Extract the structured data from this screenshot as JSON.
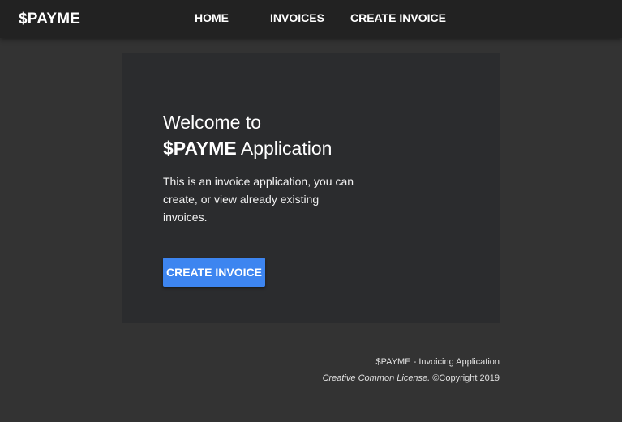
{
  "navbar": {
    "brand": "$PAYME",
    "links": [
      {
        "label": "HOME"
      },
      {
        "label": "INVOICES"
      },
      {
        "label": "CREATE INVOICE"
      }
    ]
  },
  "main": {
    "welcome_line1": "Welcome to",
    "welcome_brand": "$PAYME",
    "welcome_suffix": " Application",
    "description": "This is an invoice application, you can create, or view already existing invoices.",
    "cta_label": "CREATE INVOICE"
  },
  "footer": {
    "line1": "$PAYME - Invoicing Application",
    "license": "Creative Common License.",
    "copyright": " ©Copyright 2019"
  },
  "colors": {
    "page_background": "#333333",
    "navbar_background": "#222222",
    "card_background": "#2b2c2e",
    "accent": "#3d85f0"
  }
}
